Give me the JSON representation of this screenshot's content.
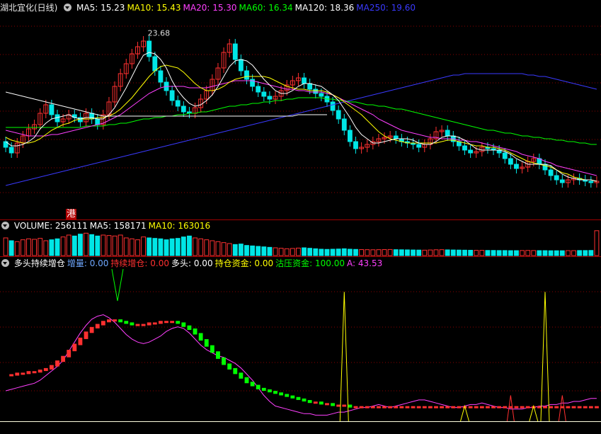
{
  "header_main": {
    "stock_name": "湖北宜化(日线)",
    "ma": [
      {
        "text": "MA5: 15.23",
        "color": "#ffffff"
      },
      {
        "text": "MA10: 15.43",
        "color": "#ffff00"
      },
      {
        "text": "MA20: 15.30",
        "color": "#ff40ff"
      },
      {
        "text": "MA60: 16.34",
        "color": "#00ff00"
      },
      {
        "text": "MA120: 18.36",
        "color": "#ffffff"
      },
      {
        "text": "MA250: 19.60",
        "color": "#3a3aff"
      }
    ]
  },
  "badge_hk": "港",
  "header_volume": [
    {
      "text": "VOLUME: 256111",
      "color": "#ffffff"
    },
    {
      "text": "MA5: 158171",
      "color": "#ffffff"
    },
    {
      "text": "MA10: 163016",
      "color": "#ffff00"
    }
  ],
  "header_indicator": [
    {
      "text": "多头持续增仓",
      "color": "#ffffff"
    },
    {
      "text": "增量: 0.00",
      "color": "#6fa8ff"
    },
    {
      "text": "持续增仓: 0.00",
      "color": "#ff3030"
    },
    {
      "text": "多头: 0.00",
      "color": "#ffffff"
    },
    {
      "text": "持仓资金: 0.00",
      "color": "#ffff00"
    },
    {
      "text": "沽压资金: 100.00",
      "color": "#00ff00"
    },
    {
      "text": "A: 43.53",
      "color": "#ff40ff"
    }
  ],
  "colors": {
    "up": "#ff3030",
    "down": "#00e6e6",
    "grid": "#8b0000",
    "ma5": "#ffffff",
    "ma10": "#ffff00",
    "ma20": "#ff40ff",
    "ma60": "#00ff00",
    "ma250": "#3a3aff"
  },
  "chart_data": [
    {
      "type": "candlestick",
      "name": "price",
      "peak_label": "23.68",
      "ylim": [
        11.5,
        25
      ],
      "closes": [
        15.6,
        15.2,
        15.9,
        16.4,
        16.9,
        17.2,
        18.0,
        18.6,
        17.9,
        17.4,
        17.6,
        17.9,
        17.7,
        17.4,
        18.0,
        17.6,
        17.2,
        17.9,
        18.8,
        19.9,
        20.8,
        21.5,
        22.2,
        22.7,
        23.1,
        22.0,
        21.0,
        20.2,
        19.6,
        18.9,
        18.5,
        18.1,
        18.0,
        18.4,
        19.0,
        19.6,
        20.4,
        21.2,
        22.3,
        22.9,
        21.8,
        21.0,
        20.4,
        19.9,
        19.5,
        19.2,
        19.0,
        19.2,
        19.6,
        20.0,
        20.3,
        20.5,
        20.1,
        19.7,
        19.4,
        19.2,
        18.8,
        18.2,
        17.6,
        16.8,
        16.0,
        15.5,
        15.6,
        15.8,
        16.0,
        16.2,
        16.3,
        16.4,
        16.2,
        16.0,
        15.9,
        15.8,
        15.6,
        15.8,
        16.2,
        16.7,
        16.8,
        16.4,
        16.0,
        15.7,
        15.4,
        15.2,
        15.3,
        15.6,
        15.5,
        15.4,
        15.2,
        14.8,
        14.4,
        14.1,
        14.2,
        14.6,
        14.8,
        14.4,
        14.0,
        13.6,
        13.3,
        13.1,
        13.3,
        13.4,
        13.3,
        13.2,
        13.1,
        13.2
      ],
      "ma5": [
        16.0,
        15.7,
        15.7,
        15.8,
        16.0,
        16.3,
        16.9,
        17.3,
        17.6,
        17.7,
        17.8,
        17.9,
        17.7,
        17.6,
        17.7,
        17.7,
        17.6,
        17.6,
        17.9,
        18.4,
        19.1,
        19.8,
        20.6,
        21.4,
        22.1,
        22.3,
        22.2,
        21.8,
        21.2,
        20.3,
        19.6,
        19.1,
        18.7,
        18.5,
        18.6,
        18.9,
        19.3,
        19.9,
        20.6,
        21.3,
        21.7,
        21.8,
        21.7,
        21.4,
        20.9,
        20.4,
        20.0,
        19.6,
        19.4,
        19.4,
        19.6,
        19.9,
        20.1,
        20.1,
        20.0,
        19.9,
        19.6,
        19.3,
        18.9,
        18.3,
        17.7,
        17.0,
        16.5,
        16.2,
        15.9,
        15.9,
        16.0,
        16.1,
        16.2,
        16.2,
        16.2,
        16.1,
        15.9,
        15.8,
        15.8,
        16.0,
        16.3,
        16.4,
        16.4,
        16.3,
        16.1,
        15.8,
        15.5,
        15.4,
        15.4,
        15.4,
        15.4,
        15.3,
        15.1,
        14.8,
        14.6,
        14.4,
        14.4,
        14.4,
        14.4,
        14.3,
        14.0,
        13.7,
        13.5,
        13.4,
        13.3,
        13.3,
        13.3,
        13.2
      ],
      "ma10": [
        16.3,
        16.1,
        16.0,
        15.9,
        15.9,
        16.0,
        16.2,
        16.5,
        16.8,
        17.0,
        17.2,
        17.3,
        17.5,
        17.6,
        17.6,
        17.6,
        17.7,
        17.7,
        17.8,
        18.0,
        18.3,
        18.7,
        19.1,
        19.6,
        20.1,
        20.6,
        21.0,
        21.3,
        21.4,
        21.3,
        21.2,
        20.9,
        20.5,
        20.1,
        19.8,
        19.6,
        19.6,
        19.7,
        19.9,
        20.2,
        20.4,
        20.5,
        20.6,
        20.6,
        20.6,
        20.6,
        20.5,
        20.3,
        20.1,
        19.9,
        19.8,
        19.7,
        19.7,
        19.6,
        19.6,
        19.6,
        19.5,
        19.3,
        19.1,
        18.8,
        18.5,
        18.2,
        17.9,
        17.5,
        17.1,
        16.7,
        16.4,
        16.2,
        16.1,
        16.0,
        15.9,
        15.9,
        15.9,
        15.9,
        15.9,
        15.9,
        16.0,
        16.1,
        16.1,
        16.0,
        15.9,
        15.8,
        15.7,
        15.7,
        15.6,
        15.6,
        15.5,
        15.4,
        15.2,
        15.0,
        14.8,
        14.6,
        14.5,
        14.4,
        14.3,
        14.2,
        14.0,
        13.8,
        13.7,
        13.5,
        13.4,
        13.3,
        13.3,
        13.2
      ],
      "ma20": [
        16.8,
        16.7,
        16.6,
        16.5,
        16.4,
        16.4,
        16.4,
        16.4,
        16.5,
        16.5,
        16.6,
        16.7,
        16.8,
        16.9,
        17.0,
        17.1,
        17.2,
        17.3,
        17.5,
        17.7,
        17.9,
        18.2,
        18.5,
        18.8,
        19.1,
        19.4,
        19.6,
        19.8,
        19.9,
        19.9,
        19.9,
        19.9,
        19.8,
        19.8,
        19.8,
        19.8,
        19.9,
        20.0,
        20.1,
        20.2,
        20.3,
        20.3,
        20.3,
        20.3,
        20.2,
        20.1,
        20.0,
        19.9,
        19.8,
        19.7,
        19.7,
        19.6,
        19.6,
        19.5,
        19.5,
        19.5,
        19.4,
        19.3,
        19.1,
        18.9,
        18.7,
        18.5,
        18.3,
        18.1,
        17.9,
        17.6,
        17.4,
        17.2,
        17.0,
        16.8,
        16.7,
        16.6,
        16.5,
        16.4,
        16.3,
        16.3,
        16.2,
        16.2,
        16.2,
        16.1,
        16.1,
        16.0,
        16.0,
        15.9,
        15.8,
        15.7,
        15.6,
        15.5,
        15.4,
        15.3,
        15.1,
        15.0,
        14.9,
        14.8,
        14.6,
        14.5,
        14.3,
        14.2,
        14.1,
        14.0,
        13.9,
        13.8,
        13.7,
        13.6
      ],
      "ma60": [
        17.0,
        17.0,
        17.0,
        17.0,
        17.0,
        17.0,
        17.0,
        17.0,
        17.0,
        17.0,
        17.0,
        17.0,
        17.0,
        17.0,
        17.1,
        17.1,
        17.1,
        17.1,
        17.2,
        17.2,
        17.3,
        17.3,
        17.4,
        17.5,
        17.6,
        17.6,
        17.7,
        17.7,
        17.8,
        17.8,
        17.9,
        17.9,
        18.0,
        18.0,
        18.1,
        18.1,
        18.2,
        18.3,
        18.4,
        18.5,
        18.5,
        18.6,
        18.6,
        18.7,
        18.7,
        18.8,
        18.8,
        18.9,
        18.9,
        19.0,
        19.0,
        19.1,
        19.1,
        19.1,
        19.1,
        19.1,
        19.0,
        19.0,
        18.9,
        18.9,
        18.8,
        18.8,
        18.7,
        18.6,
        18.6,
        18.5,
        18.5,
        18.4,
        18.3,
        18.3,
        18.2,
        18.1,
        18.0,
        17.9,
        17.8,
        17.7,
        17.6,
        17.5,
        17.4,
        17.3,
        17.2,
        17.1,
        17.0,
        16.9,
        16.8,
        16.8,
        16.7,
        16.6,
        16.6,
        16.5,
        16.4,
        16.4,
        16.3,
        16.3,
        16.2,
        16.2,
        16.1,
        16.1,
        16.0,
        16.0,
        15.9,
        15.9,
        15.8,
        15.8
      ],
      "ma120": [
        19.5,
        19.4,
        19.3,
        19.2,
        19.1,
        19.0,
        18.9,
        18.8,
        18.7,
        18.6,
        18.5,
        18.4,
        18.3,
        18.2,
        18.1,
        18.0,
        17.9,
        17.8,
        17.8,
        17.8,
        17.8,
        17.8,
        17.8,
        17.8,
        17.8,
        17.8,
        17.8,
        17.8,
        17.8,
        17.8,
        17.8,
        17.8,
        17.8,
        17.8,
        17.8,
        17.8,
        17.8,
        17.8,
        17.8,
        17.8,
        17.8,
        17.8,
        17.8,
        17.8,
        17.8,
        17.8,
        17.8,
        17.8,
        17.8,
        17.8,
        17.8,
        17.9,
        17.9,
        17.9,
        17.9,
        17.9,
        17.9
      ],
      "ma250": [
        12.9,
        13.0,
        13.1,
        13.2,
        13.3,
        13.4,
        13.5,
        13.6,
        13.7,
        13.8,
        13.9,
        14.0,
        14.1,
        14.2,
        14.3,
        14.4,
        14.5,
        14.6,
        14.7,
        14.8,
        14.9,
        15.0,
        15.1,
        15.2,
        15.3,
        15.4,
        15.5,
        15.6,
        15.7,
        15.8,
        15.9,
        16.0,
        16.1,
        16.2,
        16.3,
        16.4,
        16.5,
        16.6,
        16.7,
        16.8,
        16.9,
        17.0,
        17.1,
        17.2,
        17.3,
        17.4,
        17.5,
        17.6,
        17.7,
        17.8,
        17.9,
        18.0,
        18.1,
        18.2,
        18.3,
        18.4,
        18.5,
        18.6,
        18.7,
        18.8,
        18.9,
        19.0,
        19.1,
        19.2,
        19.3,
        19.4,
        19.5,
        19.6,
        19.7,
        19.8,
        19.9,
        20.0,
        20.1,
        20.2,
        20.3,
        20.4,
        20.5,
        20.6,
        20.7,
        20.7,
        20.8,
        20.8,
        20.8,
        20.8,
        20.8,
        20.8,
        20.8,
        20.8,
        20.8,
        20.8,
        20.8,
        20.7,
        20.7,
        20.6,
        20.6,
        20.5,
        20.4,
        20.3,
        20.2,
        20.1,
        20.0,
        19.9,
        19.8,
        19.7
      ]
    },
    {
      "type": "bar",
      "name": "volume",
      "ylim": [
        0,
        300000
      ],
      "values": [
        180000,
        150000,
        140000,
        160000,
        170000,
        165000,
        175000,
        150000,
        160000,
        170000,
        190000,
        210000,
        200000,
        220000,
        230000,
        215000,
        200000,
        210000,
        205000,
        200000,
        210000,
        180000,
        170000,
        160000,
        190000,
        180000,
        175000,
        170000,
        160000,
        170000,
        175000,
        190000,
        200000,
        180000,
        170000,
        160000,
        150000,
        140000,
        130000,
        120000,
        110000,
        115000,
        100000,
        95000,
        90000,
        85000,
        80000,
        75000,
        70000,
        65000,
        68000,
        72000,
        75000,
        70000,
        65000,
        60000,
        58000,
        60000,
        62000,
        65000,
        60000,
        58000,
        56000,
        55000,
        54000,
        55000,
        56000,
        57000,
        55000,
        54000,
        53000,
        52000,
        51000,
        50000,
        52000,
        54000,
        55000,
        53000,
        52000,
        51000,
        50000,
        49000,
        48000,
        48000,
        47000,
        47000,
        46000,
        46000,
        45000,
        45000,
        46000,
        47000,
        46000,
        45000,
        45000,
        44000,
        44000,
        44000,
        45000,
        45000,
        46000,
        46000,
        47000,
        256111
      ]
    },
    {
      "type": "indicator",
      "name": "多头持续增仓",
      "ylim": [
        0,
        100
      ],
      "line_A": [
        20,
        21,
        22,
        23,
        24,
        25,
        27,
        30,
        33,
        36,
        40,
        46,
        52,
        58,
        63,
        67,
        69,
        70,
        68,
        65,
        61,
        57,
        54,
        52,
        51,
        52,
        54,
        56,
        59,
        61,
        62,
        61,
        58,
        54,
        50,
        47,
        45,
        43,
        42,
        40,
        38,
        35,
        31,
        27,
        22,
        17,
        13,
        10,
        9,
        8,
        7,
        6,
        5,
        5,
        4,
        4,
        4,
        5,
        6,
        6,
        7,
        8,
        9,
        9,
        10,
        11,
        10,
        9,
        10,
        11,
        12,
        13,
        14,
        14,
        13,
        12,
        11,
        10,
        9,
        9,
        10,
        11,
        11,
        12,
        11,
        10,
        9,
        9,
        8,
        8,
        8,
        9,
        9,
        10,
        10,
        11,
        11,
        12,
        12,
        13,
        13,
        14,
        15,
        15
      ],
      "line_B": [
        30,
        30,
        31,
        31,
        32,
        32,
        33,
        34,
        36,
        39,
        42,
        46,
        50,
        54,
        58,
        61,
        63,
        65,
        66,
        66,
        65,
        64,
        63,
        63,
        63,
        64,
        64,
        65,
        65,
        65,
        64,
        62,
        60,
        57,
        53,
        49,
        45,
        41,
        37,
        34,
        31,
        28,
        25,
        23,
        21,
        20,
        19,
        18,
        17,
        16,
        15,
        14,
        13,
        12,
        12,
        11,
        11,
        10,
        10,
        10,
        9,
        9,
        9,
        9,
        9,
        9,
        9,
        9,
        9,
        9,
        9,
        9,
        9,
        9,
        9,
        9,
        9,
        9,
        9,
        9,
        9,
        9,
        9,
        9,
        9,
        9,
        9,
        9,
        9,
        9,
        9,
        9,
        9,
        9,
        9,
        9,
        9,
        9,
        9,
        9,
        9,
        9,
        9,
        9
      ],
      "spikes_yellow": [
        {
          "i": 59,
          "v": 85
        },
        {
          "i": 94,
          "v": 85
        },
        {
          "i": 80,
          "v": 10
        },
        {
          "i": 92,
          "v": 10
        }
      ],
      "spikes_red": [
        {
          "i": 88,
          "v": 17
        },
        {
          "i": 97,
          "v": 17
        },
        {
          "i": 109,
          "v": 17
        },
        {
          "i": 119,
          "v": 17
        }
      ]
    }
  ]
}
